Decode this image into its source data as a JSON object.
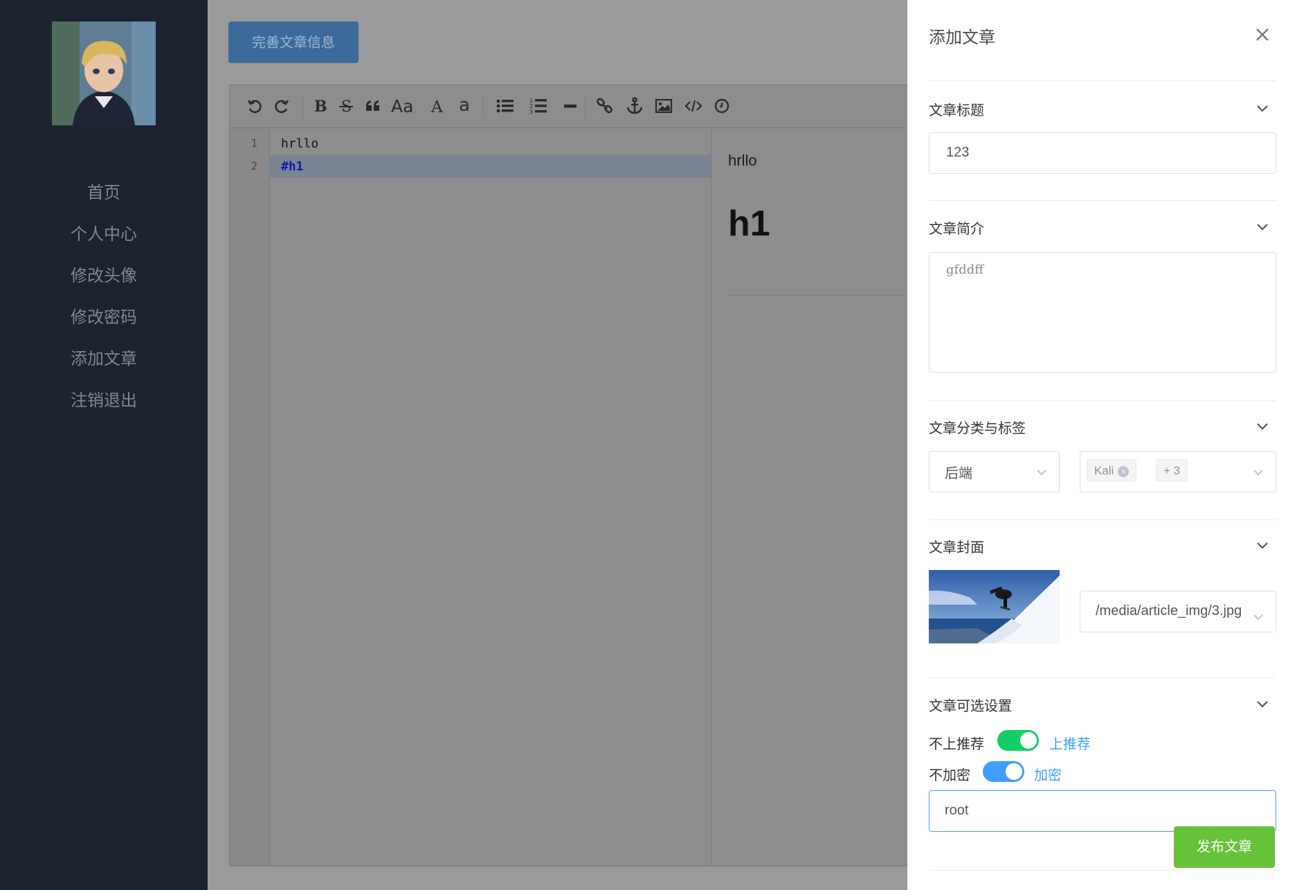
{
  "sidebar": {
    "nav": [
      {
        "label": "首页"
      },
      {
        "label": "个人中心"
      },
      {
        "label": "修改头像"
      },
      {
        "label": "修改密码"
      },
      {
        "label": "添加文章"
      },
      {
        "label": "注销退出"
      }
    ]
  },
  "main": {
    "info_button": "完善文章信息",
    "editor": {
      "line_numbers": [
        "1",
        "2"
      ],
      "lines": [
        "hrllo",
        "#h1"
      ],
      "preview_paragraph": "hrllo",
      "preview_heading": "h1"
    }
  },
  "drawer": {
    "title": "添加文章",
    "title_section": {
      "label": "文章标题",
      "value": "123"
    },
    "summary_section": {
      "label": "文章简介",
      "value": "gfddff"
    },
    "category_section": {
      "label": "文章分类与标签",
      "category": "后端",
      "tag": "Kali",
      "more_tags": "+ 3"
    },
    "cover_section": {
      "label": "文章封面",
      "path": "/media/article_img/3.jpg"
    },
    "options_section": {
      "label": "文章可选设置",
      "recommend_off": "不上推荐",
      "recommend_on": "上推荐",
      "encrypt_off": "不加密",
      "encrypt_on": "加密",
      "password": "root"
    },
    "publish_button": "发布文章"
  },
  "colors": {
    "sidebar_bg": "#1b2330",
    "primary": "#409eff",
    "success": "#67c23a",
    "switch_green": "#13ce66"
  }
}
